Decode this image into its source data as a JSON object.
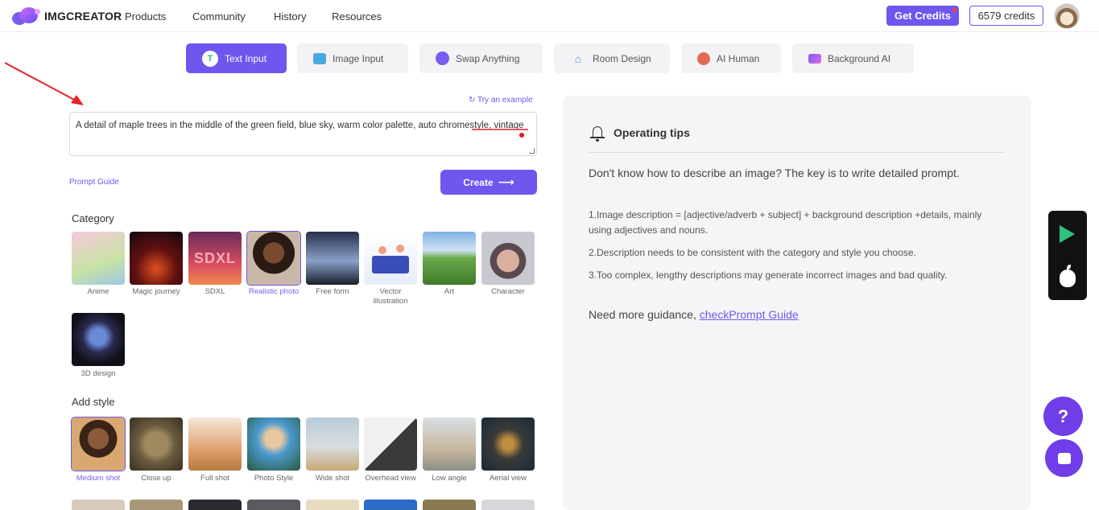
{
  "header": {
    "logo_text": "IMGCREATOR",
    "nav": [
      "Products",
      "Community",
      "History",
      "Resources"
    ],
    "get_credits": "Get Credits",
    "credits": "6579 credits"
  },
  "tabs": [
    {
      "label": "Text Input",
      "icon": "T",
      "active": true
    },
    {
      "label": "Image Input",
      "icon": "image-icon",
      "active": false
    },
    {
      "label": "Swap Anything",
      "icon": "swap-icon",
      "active": false
    },
    {
      "label": "Room Design",
      "icon": "house-icon",
      "active": false
    },
    {
      "label": "AI Human",
      "icon": "person-icon",
      "active": false
    },
    {
      "label": "Background AI",
      "icon": "background-icon",
      "active": false
    }
  ],
  "prompt": {
    "try_example": "Try an example",
    "text": "A detail of maple trees in the middle of the green field, blue sky, warm color palette, auto chromestyle, vintage",
    "guide_link": "Prompt Guide",
    "create_label": "Create",
    "create_arrow": "⟶"
  },
  "category": {
    "title": "Category",
    "items": [
      {
        "label": "Anime",
        "selected": false
      },
      {
        "label": "Magic journey",
        "selected": false
      },
      {
        "label": "SDXL",
        "selected": false
      },
      {
        "label": "Realistic photo",
        "selected": true
      },
      {
        "label": "Free form",
        "selected": false
      },
      {
        "label": "Vector illustration",
        "selected": false
      },
      {
        "label": "Art",
        "selected": false
      },
      {
        "label": "Character",
        "selected": false
      },
      {
        "label": "3D design",
        "selected": false
      }
    ],
    "sdxl_overlay": "SDXL"
  },
  "style": {
    "title": "Add style",
    "items": [
      {
        "label": "Medium shot",
        "selected": true
      },
      {
        "label": "Close up",
        "selected": false
      },
      {
        "label": "Full shot",
        "selected": false
      },
      {
        "label": "Photo Style",
        "selected": false
      },
      {
        "label": "Wide shot",
        "selected": false
      },
      {
        "label": "Overhead view",
        "selected": false
      },
      {
        "label": "Low angle",
        "selected": false
      },
      {
        "label": "Aerial view",
        "selected": false
      }
    ]
  },
  "tips": {
    "title": "Operating tips",
    "lead": "Don't know how to describe an image? The key is to write detailed prompt.",
    "items": [
      "1.Image description = [adjective/adverb + subject] + background description +details, mainly using adjectives and nouns.",
      "2.Description needs to be consistent with the category and style you choose.",
      "3.Too complex, lengthy descriptions may generate incorrect images and bad quality."
    ],
    "guidance_prefix": "Need more guidance, ",
    "guidance_link": "checkPrompt Guide"
  },
  "floating": {
    "help": "?"
  },
  "colors": {
    "accent": "#6f56ee",
    "annotation_arrow": "#e8202a"
  }
}
